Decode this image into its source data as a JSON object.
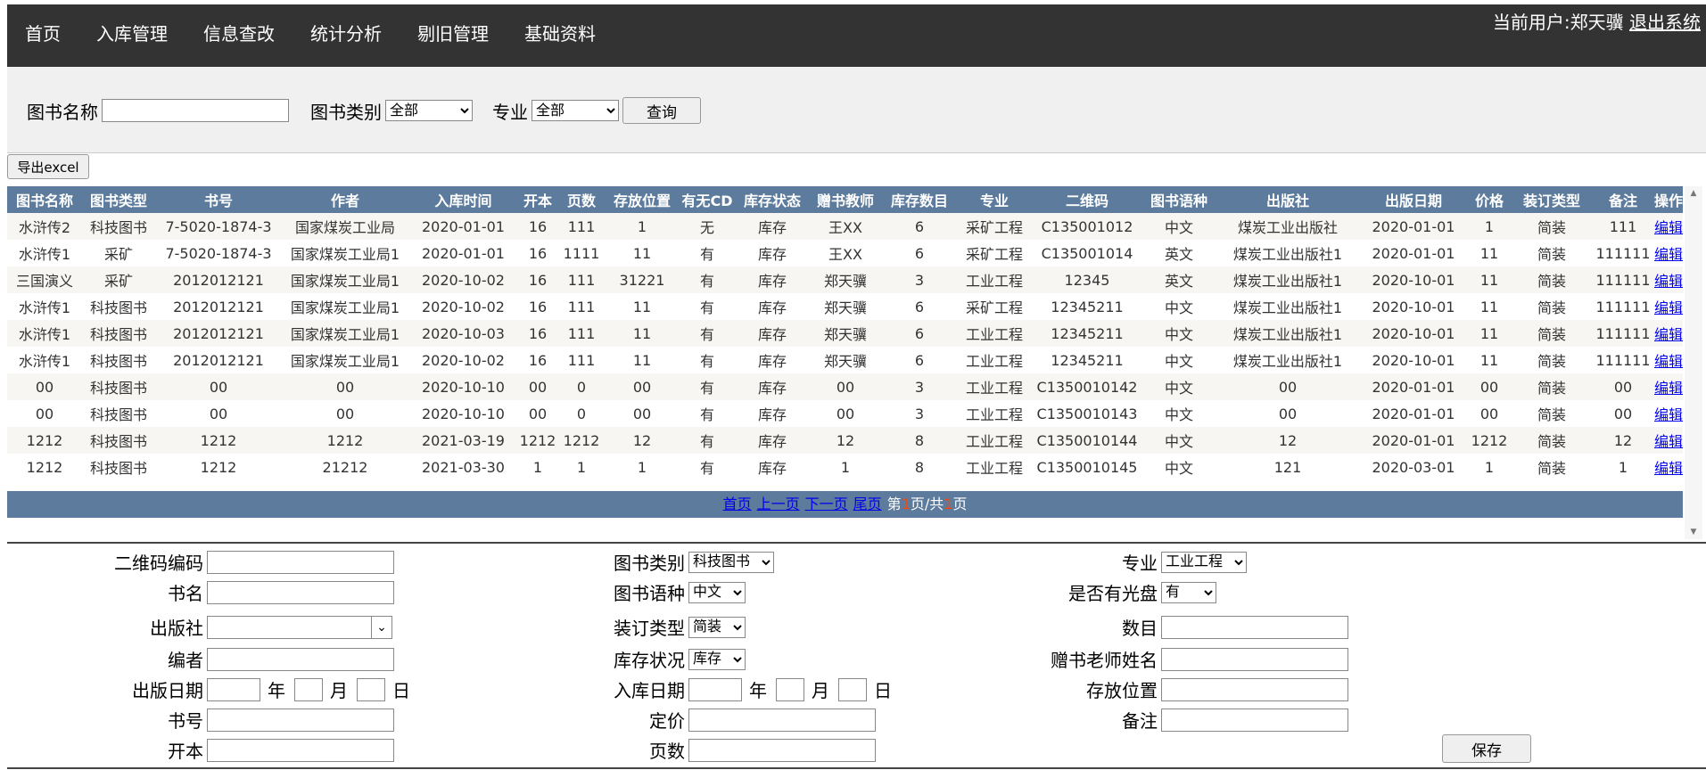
{
  "nav": {
    "items": [
      "首页",
      "入库管理",
      "信息查改",
      "统计分析",
      "剔旧管理",
      "基础资料"
    ],
    "user_label": "当前用户:郑天骥",
    "logout": "退出系统"
  },
  "search": {
    "name_label": "图书名称",
    "name_value": "",
    "category_label": "图书类别",
    "category_selected": "全部",
    "major_label": "专业",
    "major_selected": "全部",
    "query_button": "查询"
  },
  "export_button": "导出excel",
  "table": {
    "headers": [
      "图书名称",
      "图书类型",
      "书号",
      "作者",
      "入库时间",
      "开本",
      "页数",
      "存放位置",
      "有无CD",
      "库存状态",
      "赠书教师",
      "库存数目",
      "专业",
      "二维码",
      "图书语种",
      "出版社",
      "出版日期",
      "价格",
      "装订类型",
      "备注",
      "操作"
    ],
    "rows": [
      [
        "水浒传2",
        "科技图书",
        "7-5020-1874-3",
        "国家煤炭工业局",
        "2020-01-01",
        "16",
        "111",
        "1",
        "无",
        "库存",
        "王XX",
        "6",
        "采矿工程",
        "C135001012",
        "中文",
        "煤炭工业出版社",
        "2020-01-01",
        "1",
        "简装",
        "111",
        "编辑"
      ],
      [
        "水浒传1",
        "采矿",
        "7-5020-1874-3",
        "国家煤炭工业局1",
        "2020-01-01",
        "16",
        "1111",
        "11",
        "有",
        "库存",
        "王XX",
        "6",
        "采矿工程",
        "C135001014",
        "英文",
        "煤炭工业出版社1",
        "2020-01-01",
        "11",
        "简装",
        "111111",
        "编辑"
      ],
      [
        "三国演义",
        "采矿",
        "2012012121",
        "国家煤炭工业局1",
        "2020-10-02",
        "16",
        "111",
        "31221",
        "有",
        "库存",
        "郑天骥",
        "3",
        "工业工程",
        "12345",
        "英文",
        "煤炭工业出版社1",
        "2020-10-01",
        "11",
        "简装",
        "111111",
        "编辑"
      ],
      [
        "水浒传1",
        "科技图书",
        "2012012121",
        "国家煤炭工业局1",
        "2020-10-02",
        "16",
        "111",
        "11",
        "有",
        "库存",
        "郑天骥",
        "6",
        "采矿工程",
        "12345211",
        "中文",
        "煤炭工业出版社1",
        "2020-10-01",
        "11",
        "简装",
        "111111",
        "编辑"
      ],
      [
        "水浒传1",
        "科技图书",
        "2012012121",
        "国家煤炭工业局1",
        "2020-10-03",
        "16",
        "111",
        "11",
        "有",
        "库存",
        "郑天骥",
        "6",
        "工业工程",
        "12345211",
        "中文",
        "煤炭工业出版社1",
        "2020-10-01",
        "11",
        "简装",
        "111111",
        "编辑"
      ],
      [
        "水浒传1",
        "科技图书",
        "2012012121",
        "国家煤炭工业局1",
        "2020-10-02",
        "16",
        "111",
        "11",
        "有",
        "库存",
        "郑天骥",
        "6",
        "工业工程",
        "12345211",
        "中文",
        "煤炭工业出版社1",
        "2020-10-01",
        "11",
        "简装",
        "111111",
        "编辑"
      ],
      [
        "00",
        "科技图书",
        "00",
        "00",
        "2020-10-10",
        "00",
        "0",
        "00",
        "有",
        "库存",
        "00",
        "3",
        "工业工程",
        "C1350010142",
        "中文",
        "00",
        "2020-01-01",
        "00",
        "简装",
        "00",
        "编辑"
      ],
      [
        "00",
        "科技图书",
        "00",
        "00",
        "2020-10-10",
        "00",
        "0",
        "00",
        "有",
        "库存",
        "00",
        "3",
        "工业工程",
        "C1350010143",
        "中文",
        "00",
        "2020-01-01",
        "00",
        "简装",
        "00",
        "编辑"
      ],
      [
        "1212",
        "科技图书",
        "1212",
        "1212",
        "2021-03-19",
        "1212",
        "1212",
        "12",
        "有",
        "库存",
        "12",
        "8",
        "工业工程",
        "C1350010144",
        "中文",
        "12",
        "2020-01-01",
        "1212",
        "简装",
        "12",
        "编辑"
      ],
      [
        "1212",
        "科技图书",
        "1212",
        "21212",
        "2021-03-30",
        "1",
        "1",
        "1",
        "有",
        "库存",
        "1",
        "8",
        "工业工程",
        "C1350010145",
        "中文",
        "121",
        "2020-03-01",
        "1",
        "简装",
        "1",
        "编辑"
      ]
    ]
  },
  "pager": {
    "first": "首页",
    "prev": "上一页",
    "next": "下一页",
    "last": "尾页",
    "text_pre": "第",
    "current": "1",
    "text_mid": "页/共",
    "total": "1",
    "text_post": "页"
  },
  "form": {
    "qrcode_label": "二维码编码",
    "qrcode_value": "",
    "title_label": "书名",
    "title_value": "",
    "publisher_label": "出版社",
    "publisher_value": "",
    "editor_label": "编者",
    "editor_value": "",
    "pubdate_label": "出版日期",
    "year_label": "年",
    "month_label": "月",
    "day_label": "日",
    "isbn_label": "书号",
    "isbn_value": "",
    "format_label": "开本",
    "format_value": "",
    "category_label": "图书类别",
    "category_selected": "科技图书",
    "language_label": "图书语种",
    "language_selected": "中文",
    "binding_label": "装订类型",
    "binding_selected": "简装",
    "stock_label": "库存状况",
    "stock_selected": "库存",
    "instock_label": "入库日期",
    "price_label": "定价",
    "price_value": "",
    "pages_label": "页数",
    "pages_value": "",
    "major_label": "专业",
    "major_selected": "工业工程",
    "cd_label": "是否有光盘",
    "cd_selected": "有",
    "count_label": "数目",
    "count_value": "",
    "donor_label": "赠书老师姓名",
    "donor_value": "",
    "location_label": "存放位置",
    "location_value": "",
    "remark_label": "备注",
    "remark_value": "",
    "save_button": "保存"
  }
}
